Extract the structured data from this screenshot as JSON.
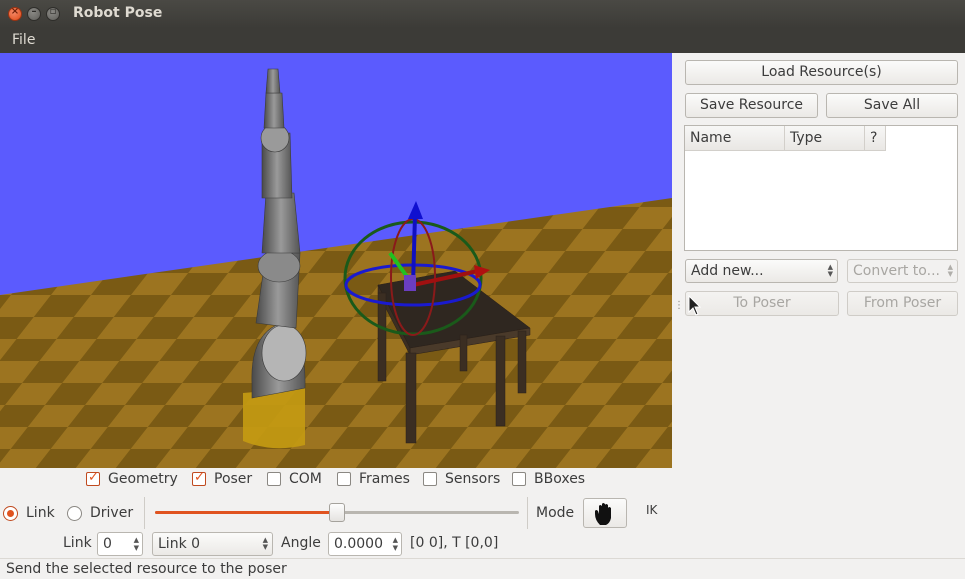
{
  "window": {
    "title": "Robot Pose"
  },
  "menu": {
    "file": "File"
  },
  "resources": {
    "load_label": "Load Resource(s)",
    "save_label": "Save Resource",
    "save_all_label": "Save All",
    "columns": [
      "Name",
      "Type",
      "?"
    ],
    "add_new": "Add new...",
    "convert_to": "Convert to...",
    "to_poser": "To Poser",
    "from_poser": "From Poser"
  },
  "display": {
    "geometry": {
      "label": "Geometry",
      "checked": true
    },
    "poser": {
      "label": "Poser",
      "checked": true
    },
    "com": {
      "label": "COM",
      "checked": false
    },
    "frames": {
      "label": "Frames",
      "checked": false
    },
    "sensors": {
      "label": "Sensors",
      "checked": false
    },
    "bboxes": {
      "label": "BBoxes",
      "checked": false
    }
  },
  "controls": {
    "link_radio": "Link",
    "driver_radio": "Driver",
    "slider_fraction": 0.5,
    "mode_label": "Mode",
    "ik_label": "IK",
    "link_label": "Link",
    "link_index": "0",
    "link_name": "Link 0",
    "angle_label": "Angle",
    "angle_value": "0.0000",
    "limits_text": "[0 0], T [0,0]"
  },
  "status": {
    "text": "Send the selected resource to the poser"
  },
  "colors": {
    "sky": "#5b5bfe",
    "accent": "#e0531f",
    "titlebar": "#3c3b37"
  }
}
